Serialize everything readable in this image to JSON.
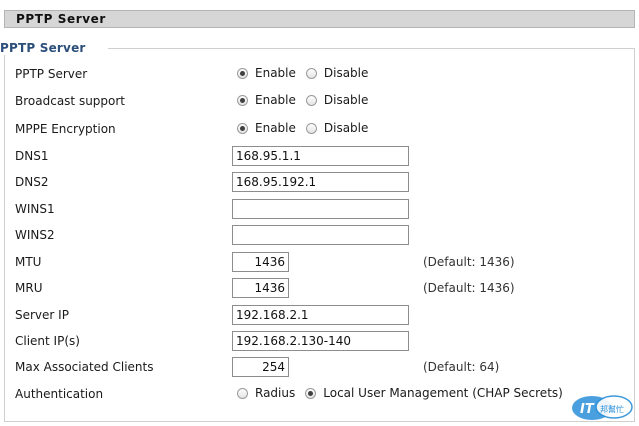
{
  "header": {
    "title": "PPTP Server"
  },
  "section": {
    "legend": "PPTP Server"
  },
  "pptp_server": {
    "label": "PPTP Server",
    "enable_label": "Enable",
    "disable_label": "Disable",
    "selected": "Enable"
  },
  "broadcast_support": {
    "label": "Broadcast support",
    "enable_label": "Enable",
    "disable_label": "Disable",
    "selected": "Enable"
  },
  "mppe_encryption": {
    "label": "MPPE Encryption",
    "enable_label": "Enable",
    "disable_label": "Disable",
    "selected": "Enable"
  },
  "dns1": {
    "label": "DNS1",
    "value": "168.95.1.1"
  },
  "dns2": {
    "label": "DNS2",
    "value": "168.95.192.1"
  },
  "wins1": {
    "label": "WINS1",
    "value": ""
  },
  "wins2": {
    "label": "WINS2",
    "value": ""
  },
  "mtu": {
    "label": "MTU",
    "value": "1436",
    "hint": "(Default: 1436)"
  },
  "mru": {
    "label": "MRU",
    "value": "1436",
    "hint": "(Default: 1436)"
  },
  "server_ip": {
    "label": "Server IP",
    "value": "192.168.2.1"
  },
  "client_ips": {
    "label": "Client IP(s)",
    "value": "192.168.2.130-140"
  },
  "max_clients": {
    "label": "Max Associated Clients",
    "value": "254",
    "hint": "(Default: 64)"
  },
  "authentication": {
    "label": "Authentication",
    "radius_label": "Radius",
    "local_label": "Local User Management (CHAP Secrets)",
    "selected": "Local User Management (CHAP Secrets)"
  },
  "watermark": {
    "text": "iT邦幫忙"
  }
}
